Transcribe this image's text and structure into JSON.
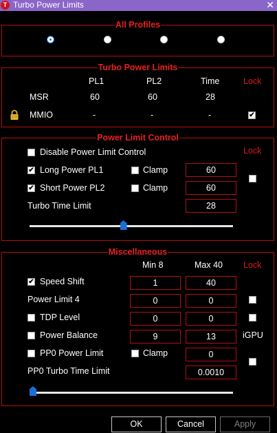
{
  "window": {
    "title": "Turbo Power Limits",
    "app_icon": "T",
    "close_glyph": "✕"
  },
  "all_profiles": {
    "legend": "All Profiles",
    "selected_index": 0,
    "count": 4
  },
  "turbo_power_limits": {
    "legend": "Turbo Power Limits",
    "headers": {
      "pl1": "PL1",
      "pl2": "PL2",
      "time": "Time",
      "lock": "Lock"
    },
    "msr": {
      "label": "MSR",
      "pl1": "60",
      "pl2": "60",
      "time": "28"
    },
    "mmio": {
      "label": "MMIO",
      "pl1": "-",
      "pl2": "-",
      "time": "-",
      "lock_checked": true
    }
  },
  "power_limit_control": {
    "legend": "Power Limit Control",
    "lock_label": "Lock",
    "disable_label": "Disable Power Limit Control",
    "disable_checked": false,
    "long_label": "Long Power PL1",
    "long_checked": true,
    "long_clamp_label": "Clamp",
    "long_clamp_checked": false,
    "long_value": "60",
    "short_label": "Short Power PL2",
    "short_checked": true,
    "short_clamp_label": "Clamp",
    "short_clamp_checked": false,
    "short_value": "60",
    "lock_checked": false,
    "turbo_time_label": "Turbo Time Limit",
    "turbo_time_value": "28",
    "turbo_time_slider_fraction": 0.46
  },
  "miscellaneous": {
    "legend": "Miscellaneous",
    "min_label": "Min  8",
    "max_label": "Max  40",
    "lock_label": "Lock",
    "igpu_label": "iGPU",
    "rows": [
      {
        "label": "Speed Shift",
        "has_checkbox": true,
        "checked": true,
        "min": "1",
        "max": "40"
      },
      {
        "label": "Power Limit 4",
        "has_checkbox": false,
        "checked": false,
        "min": "0",
        "max": "0",
        "lock_checked": false
      },
      {
        "label": "TDP Level",
        "has_checkbox": true,
        "checked": false,
        "min": "0",
        "max": "0",
        "lock_checked": false
      },
      {
        "label": "Power Balance",
        "has_checkbox": true,
        "checked": false,
        "min": "9",
        "max": "13"
      }
    ],
    "pp0": {
      "label": "PP0 Power Limit",
      "checked": false,
      "clamp_label": "Clamp",
      "clamp_checked": false,
      "value": "0",
      "lock_checked": false
    },
    "pp0_time_label": "PP0 Turbo Time Limit",
    "pp0_time_value": "0.0010",
    "pp0_time_slider_fraction": 0.0
  },
  "buttons": {
    "ok": "OK",
    "cancel": "Cancel",
    "apply": "Apply"
  }
}
